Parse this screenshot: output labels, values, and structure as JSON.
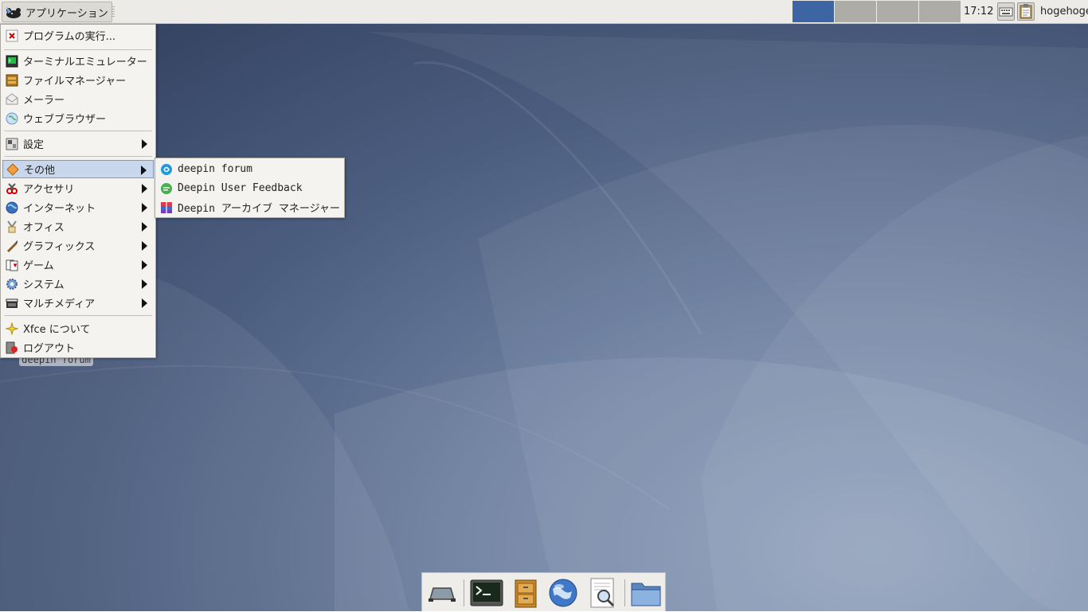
{
  "panel": {
    "apps_label": "アプリケーション",
    "clock": "17:12",
    "username": "hogehoge",
    "workspaces": [
      "",
      "",
      "",
      ""
    ],
    "active_workspace": 1
  },
  "main_menu": {
    "items": [
      {
        "label": "プログラムの実行...",
        "icon": "run-program-icon"
      },
      {
        "label": "ターミナルエミュレーター",
        "icon": "terminal-icon"
      },
      {
        "label": "ファイルマネージャー",
        "icon": "file-manager-icon"
      },
      {
        "label": "メーラー",
        "icon": "mail-icon"
      },
      {
        "label": "ウェブブラウザー",
        "icon": "web-browser-icon"
      },
      {
        "label": "設定",
        "icon": "settings-icon",
        "submenu": true
      },
      {
        "label": "その他",
        "icon": "other-icon",
        "submenu": true,
        "highlighted": true
      },
      {
        "label": "アクセサリ",
        "icon": "accessories-icon",
        "submenu": true
      },
      {
        "label": "インターネット",
        "icon": "internet-icon",
        "submenu": true
      },
      {
        "label": "オフィス",
        "icon": "office-icon",
        "submenu": true
      },
      {
        "label": "グラフィックス",
        "icon": "graphics-icon",
        "submenu": true
      },
      {
        "label": "ゲーム",
        "icon": "games-icon",
        "submenu": true
      },
      {
        "label": "システム",
        "icon": "system-icon",
        "submenu": true
      },
      {
        "label": "マルチメディア",
        "icon": "multimedia-icon",
        "submenu": true
      },
      {
        "label": "Xfce について",
        "icon": "about-xfce-icon"
      },
      {
        "label": "ログアウト",
        "icon": "logout-icon"
      }
    ]
  },
  "sub_menu": {
    "items": [
      {
        "label": "deepin forum",
        "icon": "deepin-forum-icon"
      },
      {
        "label": "Deepin User Feedback",
        "icon": "feedback-icon"
      },
      {
        "label": "Deepin アーカイブ マネージャー",
        "icon": "archive-manager-icon"
      }
    ]
  },
  "desktop": {
    "icon_label": "deepin forum"
  },
  "dock": {
    "items": [
      "show-desktop-icon",
      "terminal-icon",
      "file-cabinet-icon",
      "web-browser-icon",
      "search-icon",
      "folder-icon"
    ]
  },
  "colors": {
    "panel_bg": "#ecebe8",
    "active_workspace": "#3d65a3",
    "inactive_workspace": "#aeaca6",
    "menu_bg": "#f4f3ef",
    "menu_highlight": "#c8d7ec"
  }
}
